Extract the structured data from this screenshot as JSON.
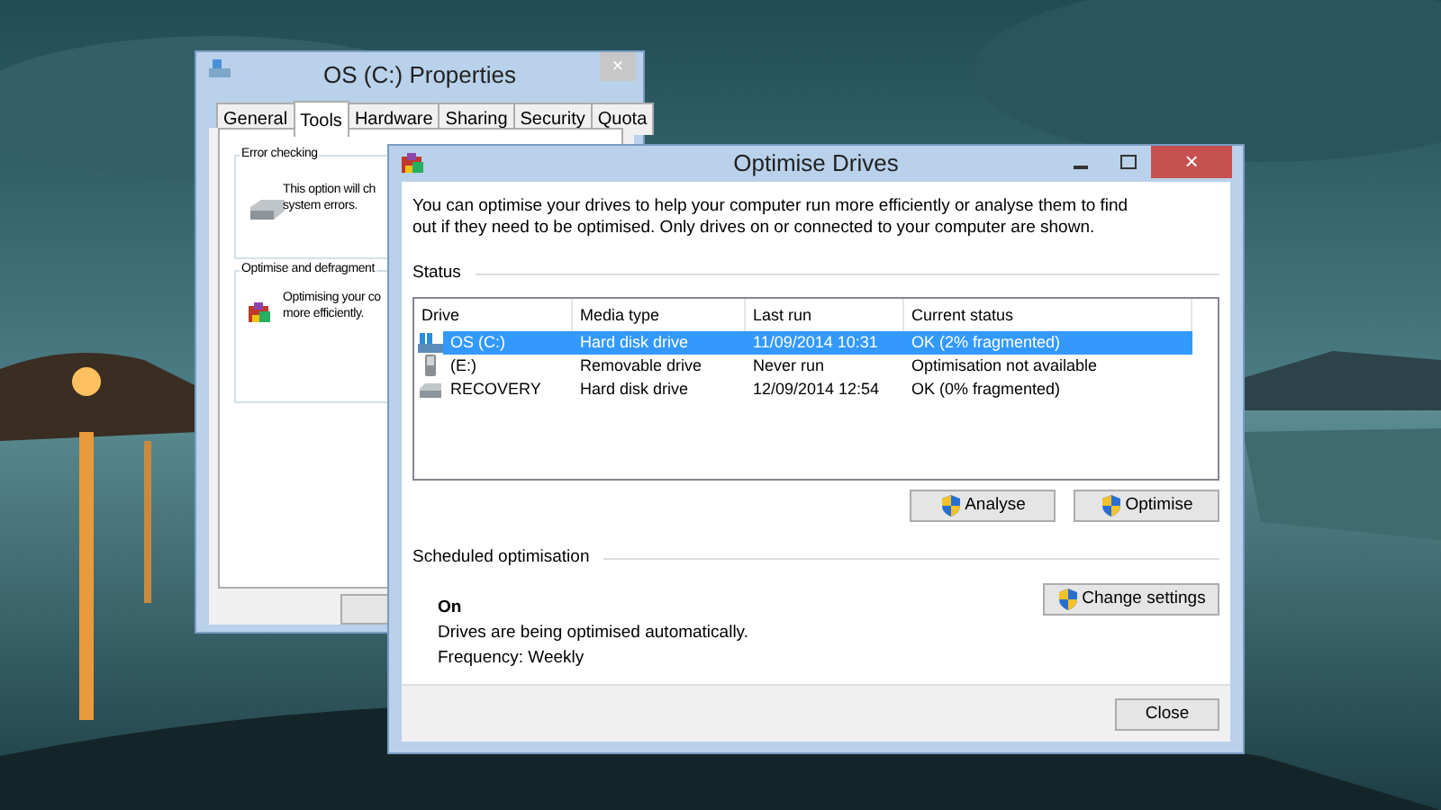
{
  "background_window": {
    "title": "OS (C:) Properties",
    "close_glyph": "×",
    "tabs": [
      {
        "label": "General",
        "selected": false
      },
      {
        "label": "Tools",
        "selected": true
      },
      {
        "label": "Hardware",
        "selected": false
      },
      {
        "label": "Sharing",
        "selected": false
      },
      {
        "label": "Security",
        "selected": false
      },
      {
        "label": "Quota",
        "selected": false
      }
    ],
    "groups": [
      {
        "title": "Error checking",
        "kind": "check",
        "lines": [
          "This option will ch",
          "system errors."
        ]
      },
      {
        "title": "Optimise and defragment",
        "kind": "defrag",
        "lines": [
          "Optimising your co",
          "more efficiently."
        ]
      }
    ]
  },
  "window": {
    "title": "Optimise Drives",
    "close_glyph": "×",
    "description": "You can optimise your drives to help your computer run more efficiently or analyse them to find out if they need to be optimised. Only drives on or connected to your computer are shown.",
    "status_heading": "Status",
    "table": {
      "columns": [
        "Drive",
        "Media type",
        "Last run",
        "Current status"
      ],
      "rows": [
        {
          "kind": "system",
          "drive": "OS (C:)",
          "media_type": "Hard disk drive",
          "last_run": "11/09/2014 10:31",
          "current_status": "OK (2% fragmented)",
          "selected": true
        },
        {
          "kind": "removable",
          "drive": "(E:)",
          "media_type": "Removable drive",
          "last_run": "Never run",
          "current_status": "Optimisation not available",
          "selected": false
        },
        {
          "kind": "disk",
          "drive": "RECOVERY",
          "media_type": "Hard disk drive",
          "last_run": "12/09/2014 12:54",
          "current_status": "OK (0% fragmented)",
          "selected": false
        }
      ]
    },
    "buttons": [
      "Analyse",
      "Optimise"
    ],
    "scheduled": {
      "heading": "Scheduled optimisation",
      "state": "On",
      "description": "Drives are being optimised automatically.",
      "frequency": "Frequency: Weekly",
      "button": "Change settings"
    },
    "close_button": "Close"
  }
}
